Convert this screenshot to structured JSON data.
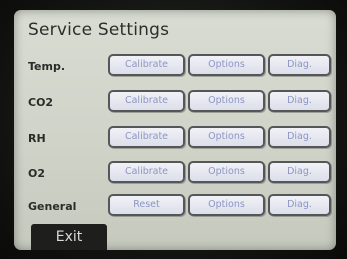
{
  "screen": {
    "title": "Service Settings",
    "rows": [
      {
        "label": "Temp.",
        "buttons": [
          "Calibrate",
          "Options",
          "Diag."
        ]
      },
      {
        "label": "CO2",
        "buttons": [
          "Calibrate",
          "Options",
          "Diag."
        ]
      },
      {
        "label": "RH",
        "buttons": [
          "Calibrate",
          "Options",
          "Diag."
        ]
      },
      {
        "label": "O2",
        "buttons": [
          "Calibrate",
          "Options",
          "Diag."
        ]
      },
      {
        "label": "General",
        "buttons": [
          "Reset",
          "Options",
          "Diag."
        ]
      }
    ],
    "exit_label": "Exit"
  },
  "colors": {
    "button_text": "#8c95c4",
    "button_border": "#55565a",
    "exit_bg": "#1e1f1c"
  }
}
